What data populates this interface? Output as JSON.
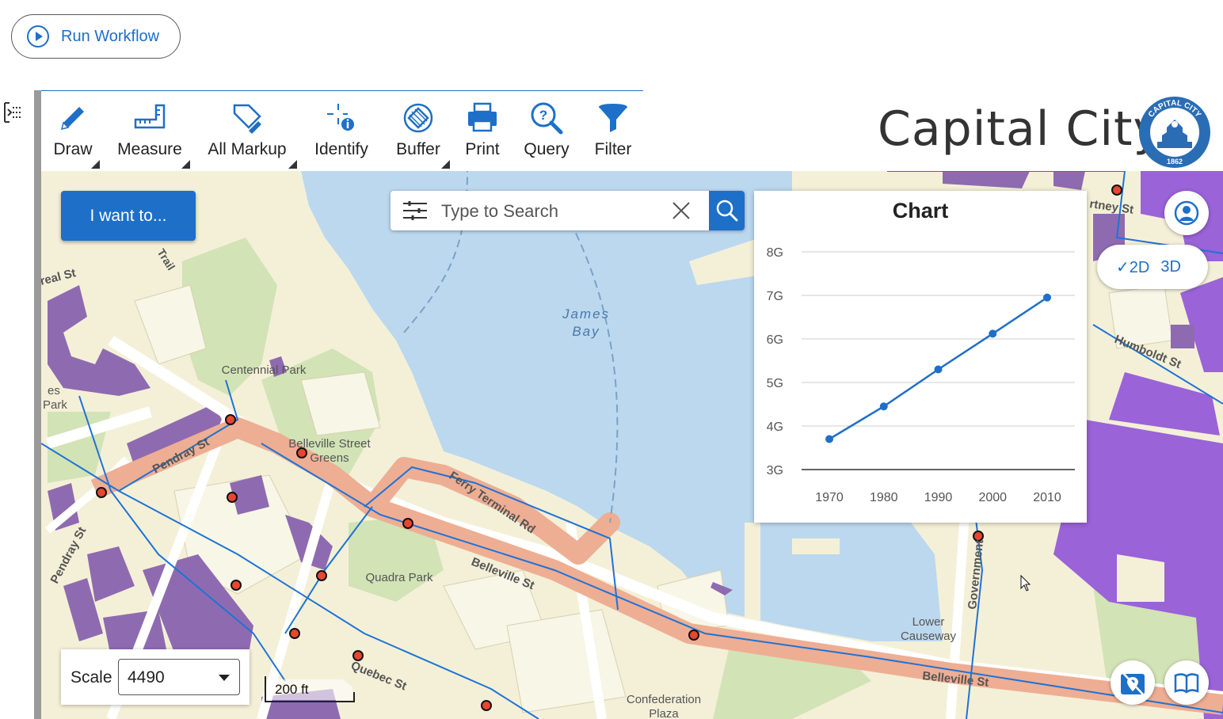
{
  "workflow": {
    "run_label": "Run Workflow"
  },
  "toolbar": {
    "tools": [
      {
        "label": "Draw",
        "icon": "pencil-icon",
        "has_menu": true
      },
      {
        "label": "Measure",
        "icon": "ruler-icon",
        "has_menu": true
      },
      {
        "label": "All Markup",
        "icon": "markup-tag-icon",
        "has_menu": true
      },
      {
        "label": "Identify",
        "icon": "identify-icon",
        "has_menu": false
      },
      {
        "label": "Buffer",
        "icon": "buffer-icon",
        "has_menu": true
      },
      {
        "label": "Print",
        "icon": "printer-icon",
        "has_menu": false
      },
      {
        "label": "Query",
        "icon": "query-magnifier-icon",
        "has_menu": false
      },
      {
        "label": "Filter",
        "icon": "funnel-icon",
        "has_menu": false
      }
    ]
  },
  "brand": {
    "title": "Capital City",
    "seal_text": "CAPITAL CITY",
    "seal_year": "1862"
  },
  "map": {
    "i_want_to_label": "I want to...",
    "search": {
      "placeholder": "Type to Search",
      "value": ""
    },
    "labels": {
      "james_bay_1": "James",
      "james_bay_2": "Bay",
      "centennial_park": "Centennial Park",
      "belleville_greens_1": "Belleville Street",
      "belleville_greens_2": "Greens",
      "pendray_st": "Pendray St",
      "pendray_st_2": "Pendray St",
      "ferry_terminal": "Ferry Terminal Rd",
      "belleville_st": "Belleville St",
      "belleville_st_2": "Belleville St",
      "quadra_park": "Quadra Park",
      "quebec_st": "Quebec St",
      "lower_causeway_1": "Lower",
      "lower_causeway_2": "Causeway",
      "confederation_1": "Confederation",
      "confederation_2": "Plaza",
      "government": "Government",
      "humboldt_st": "Humboldt St",
      "courtney_st": "rtney St",
      "real_st": "real St",
      "trail": "Trail",
      "es_park_1": "es",
      "es_park_2": "Park"
    },
    "view_toggle": {
      "option_2d": "✓2D",
      "option_3d": "3D",
      "selected": "2D"
    },
    "scale": {
      "label": "Scale",
      "value": "4490"
    },
    "scalebar_label": "200 ft",
    "colors": {
      "water": "#bcd8ef",
      "land": "#f4f0d8",
      "park": "#d2e3b6",
      "building": "#8e6bb0",
      "building_bright": "#9a63d8",
      "route": "#eeae93",
      "accent": "#1e6fc8"
    }
  },
  "chart_data": {
    "type": "line",
    "title": "Chart",
    "categories": [
      "1970",
      "1980",
      "1990",
      "2000",
      "2010"
    ],
    "series": [
      {
        "values": [
          3.7,
          4.45,
          5.3,
          6.12,
          6.95
        ]
      }
    ],
    "y_ticks": [
      "3G",
      "4G",
      "5G",
      "6G",
      "7G",
      "8G"
    ],
    "ylim": [
      3,
      8
    ],
    "grid": true,
    "color": "#1e6fc8"
  }
}
